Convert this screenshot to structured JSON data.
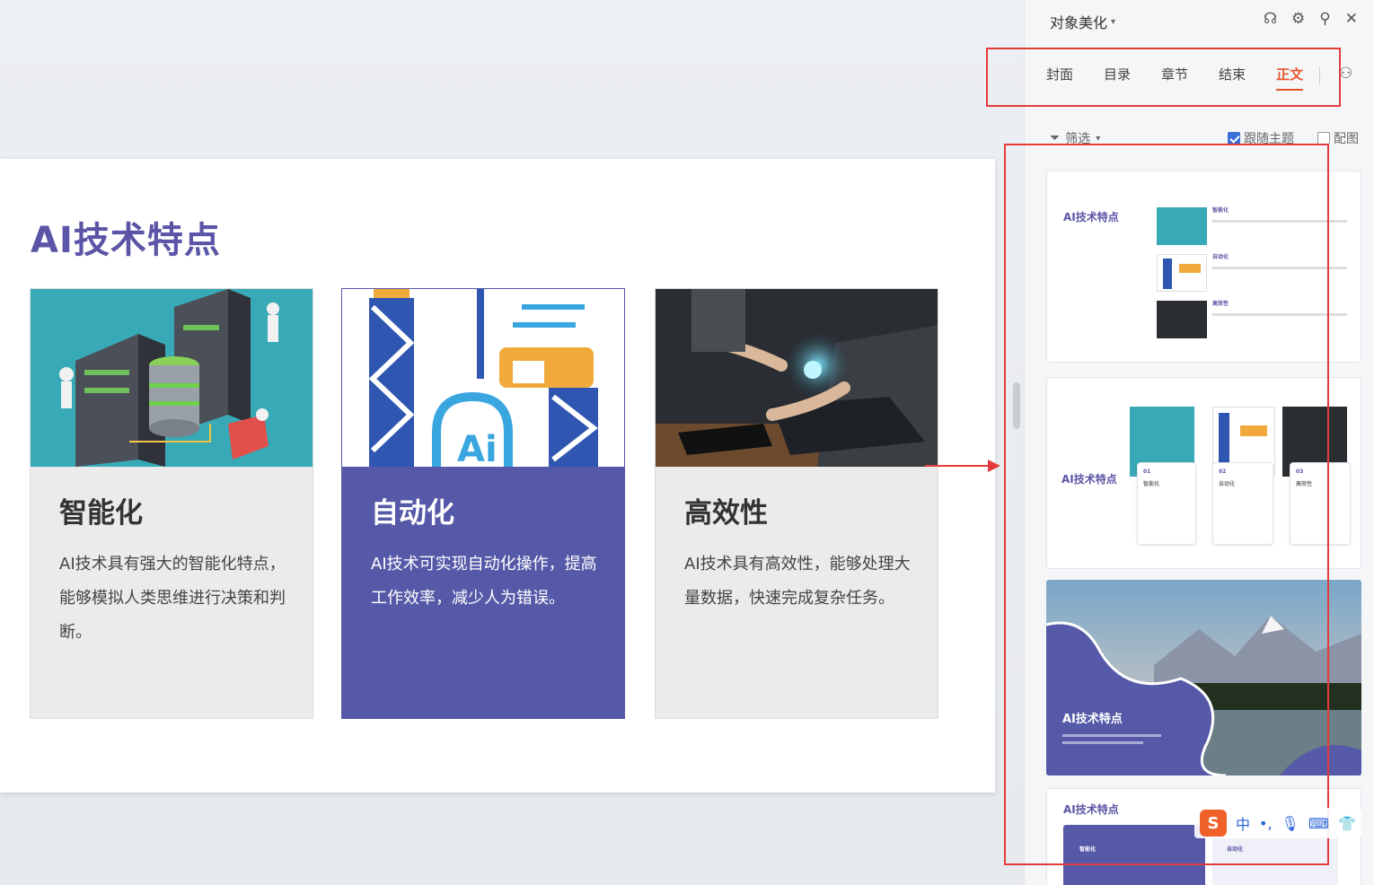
{
  "slide": {
    "title": "AI技术特点",
    "cards": [
      {
        "title": "智能化",
        "body": "AI技术具有强大的智能化特点，能够模拟人类思维进行决策和判断。"
      },
      {
        "title": "自动化",
        "body": "AI技术可实现自动化操作，提高工作效率，减少人为错误。"
      },
      {
        "title": "高效性",
        "body": "AI技术具有高效性，能够处理大量数据，快速完成复杂任务。"
      }
    ]
  },
  "panel": {
    "title": "对象美化",
    "tabs": [
      "封面",
      "目录",
      "章节",
      "结束",
      "正文"
    ],
    "active_tab": "正文",
    "filter_label": "筛选",
    "follow_theme_label": "跟随主题",
    "match_image_label": "配图",
    "thumbnails": [
      {
        "title": "AI技术特点",
        "items": [
          "智能化",
          "自动化",
          "高效性"
        ]
      },
      {
        "title": "AI技术特点",
        "nums": [
          "01",
          "02",
          "03"
        ],
        "items": [
          "智能化",
          "自动化",
          "高效性"
        ]
      },
      {
        "title": "AI技术特点"
      },
      {
        "title": "AI技术特点",
        "items": [
          "智能化",
          "自动化"
        ]
      }
    ]
  },
  "ime": {
    "lang": "中"
  },
  "colors": {
    "accent": "#5659a8",
    "tab_active": "#e6542b",
    "annotation": "#e33b3b"
  }
}
